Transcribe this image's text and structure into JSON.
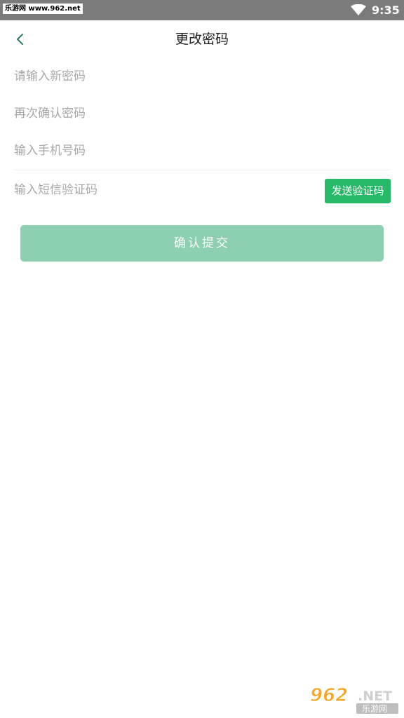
{
  "status_bar": {
    "watermark": "乐游网 www.962.net",
    "time": "9:35",
    "icons": [
      "wifi-icon"
    ]
  },
  "nav": {
    "back_icon": "chevron-left-icon",
    "title": "更改密码"
  },
  "form": {
    "new_password_placeholder": "请输入新密码",
    "confirm_password_placeholder": "再次确认密码",
    "phone_placeholder": "输入手机号码",
    "sms_code_placeholder": "输入短信验证码",
    "send_code_label": "发送验证码",
    "submit_label": "确认提交"
  },
  "watermark_logo": {
    "text_main": "962.NET",
    "text_sub": "乐游网"
  },
  "colors": {
    "primary_green": "#26ba68",
    "submit_disabled": "#8ccfb1",
    "status_bar": "#7b7b7b",
    "placeholder": "#a8a8a8"
  }
}
